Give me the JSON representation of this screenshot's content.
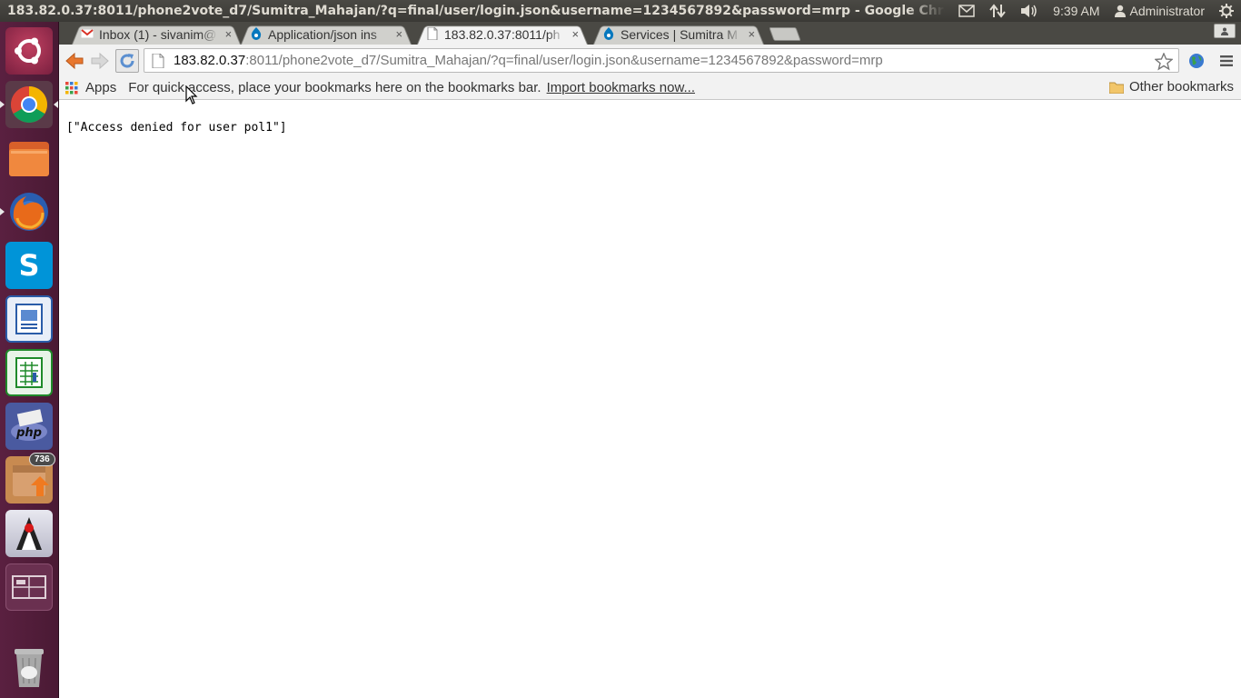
{
  "top_panel": {
    "window_title": "183.82.0.37:8011/phone2vote_d7/Sumitra_Mahajan/?q=final/user/login.json&username=1234567892&password=mrp - Google Chrome",
    "clock": "9:39 AM",
    "user": "Administrator",
    "indicator_icons": [
      "mail-icon",
      "network-updown-icon",
      "volume-icon",
      "clock",
      "user-icon",
      "session-gear-icon"
    ]
  },
  "launcher": {
    "items": [
      {
        "name": "ubuntu-dash",
        "icon": "ubuntu-logo-icon"
      },
      {
        "name": "chrome",
        "icon": "chrome-icon",
        "running": true
      },
      {
        "name": "files",
        "icon": "folder-icon"
      },
      {
        "name": "firefox",
        "icon": "firefox-icon",
        "running": true
      },
      {
        "name": "skype",
        "icon": "skype-icon"
      },
      {
        "name": "libreoffice-writer",
        "icon": "writer-icon"
      },
      {
        "name": "libreoffice-calc",
        "icon": "calc-icon"
      },
      {
        "name": "php",
        "icon": "php-icon",
        "label": "php"
      },
      {
        "name": "software-updater",
        "icon": "updater-icon",
        "badge": "736"
      },
      {
        "name": "netbeans-java",
        "icon": "java-duke-icon"
      },
      {
        "name": "workspace-switcher",
        "icon": "workspace-icon"
      },
      {
        "name": "trash",
        "icon": "trash-icon"
      }
    ]
  },
  "tabs": [
    {
      "label": "Inbox (1) - sivanim@",
      "icon": "gmail-icon",
      "active": false
    },
    {
      "label": "Application/json ins",
      "icon": "drupal-icon",
      "active": false
    },
    {
      "label": "183.82.0.37:8011/ph",
      "icon": "page-icon",
      "active": true
    },
    {
      "label": "Services | Sumitra M",
      "icon": "drupal-icon",
      "active": false
    }
  ],
  "tab_close_glyph": "×",
  "omnibox": {
    "host": "183.82.0.37",
    "rest": ":8011/phone2vote_d7/Sumitra_Mahajan/?q=final/user/login.json&username=1234567892&password=mrp"
  },
  "bookmarks_bar": {
    "apps_label": "Apps",
    "hint": "For quick access, place your bookmarks here on the bookmarks bar.",
    "import_link": "Import bookmarks now...",
    "other_bookmarks": "Other bookmarks"
  },
  "page": {
    "body_text": "[\"Access denied for user pol1\"]"
  },
  "colors": {
    "launcher_bg": "#4a1a34",
    "panel_bg": "#3c3b37",
    "back_arrow": "#e8772e",
    "reload_blue": "#5b8fd0"
  }
}
